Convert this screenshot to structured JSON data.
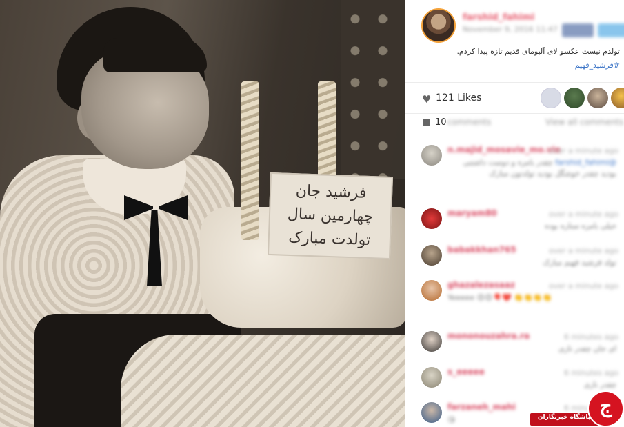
{
  "post": {
    "username": "farshid_fahimi",
    "date": "November 9, 2016 11:47",
    "caption": "تولدم نیست عکسو لای آلبومای قدیم تازه پیدا کردم.",
    "hashtag": "#فرشید_فهیم",
    "photo_sign_lines": [
      "فرشید جان",
      "چهارمین سال",
      "تولدت مبارک"
    ]
  },
  "likes": {
    "count": "121",
    "label": "Likes",
    "icon": "heart-icon"
  },
  "comments_bar": {
    "count": "10",
    "label": "comments",
    "view_all": "View all comments",
    "icon": "speech-bubble-icon"
  },
  "comments": [
    {
      "user": "n.majid_mosavie_mo.vie",
      "time": "over a minute ago",
      "mention": "@farshid_fahimi",
      "text": "چقدر بامزه و دوست داشتنی بودید چقدر خوشگل بودید تولدتون مبارک"
    },
    {
      "user": "maryam80",
      "time": "over a minute ago",
      "mention": "",
      "text": "خیلی بامزه ستاره بوده"
    },
    {
      "user": "babakkhan765",
      "time": "over a minute ago",
      "mention": "",
      "text": "تولد فرشید فهیم مبارک"
    },
    {
      "user": "ghazalezasaaz",
      "time": "over a minute ago",
      "mention": "",
      "text": "Yeeeee 😍😍🎈❤️ 👏👏👏👏"
    },
    {
      "user": "mononouzahra.ra",
      "time": "6 minutes ago",
      "mention": "",
      "text": "ای جان چقدر نازی"
    },
    {
      "user": "s_eeeee",
      "time": "6 minutes ago",
      "mention": "",
      "text": "چقدر نازی"
    },
    {
      "user": "farzaneh_mahi",
      "time": "6 minutes ago",
      "mention": "",
      "text": "😘"
    }
  ],
  "watermark": {
    "text": "باشگاه خبرنگاران",
    "logo_letter": "ج"
  }
}
